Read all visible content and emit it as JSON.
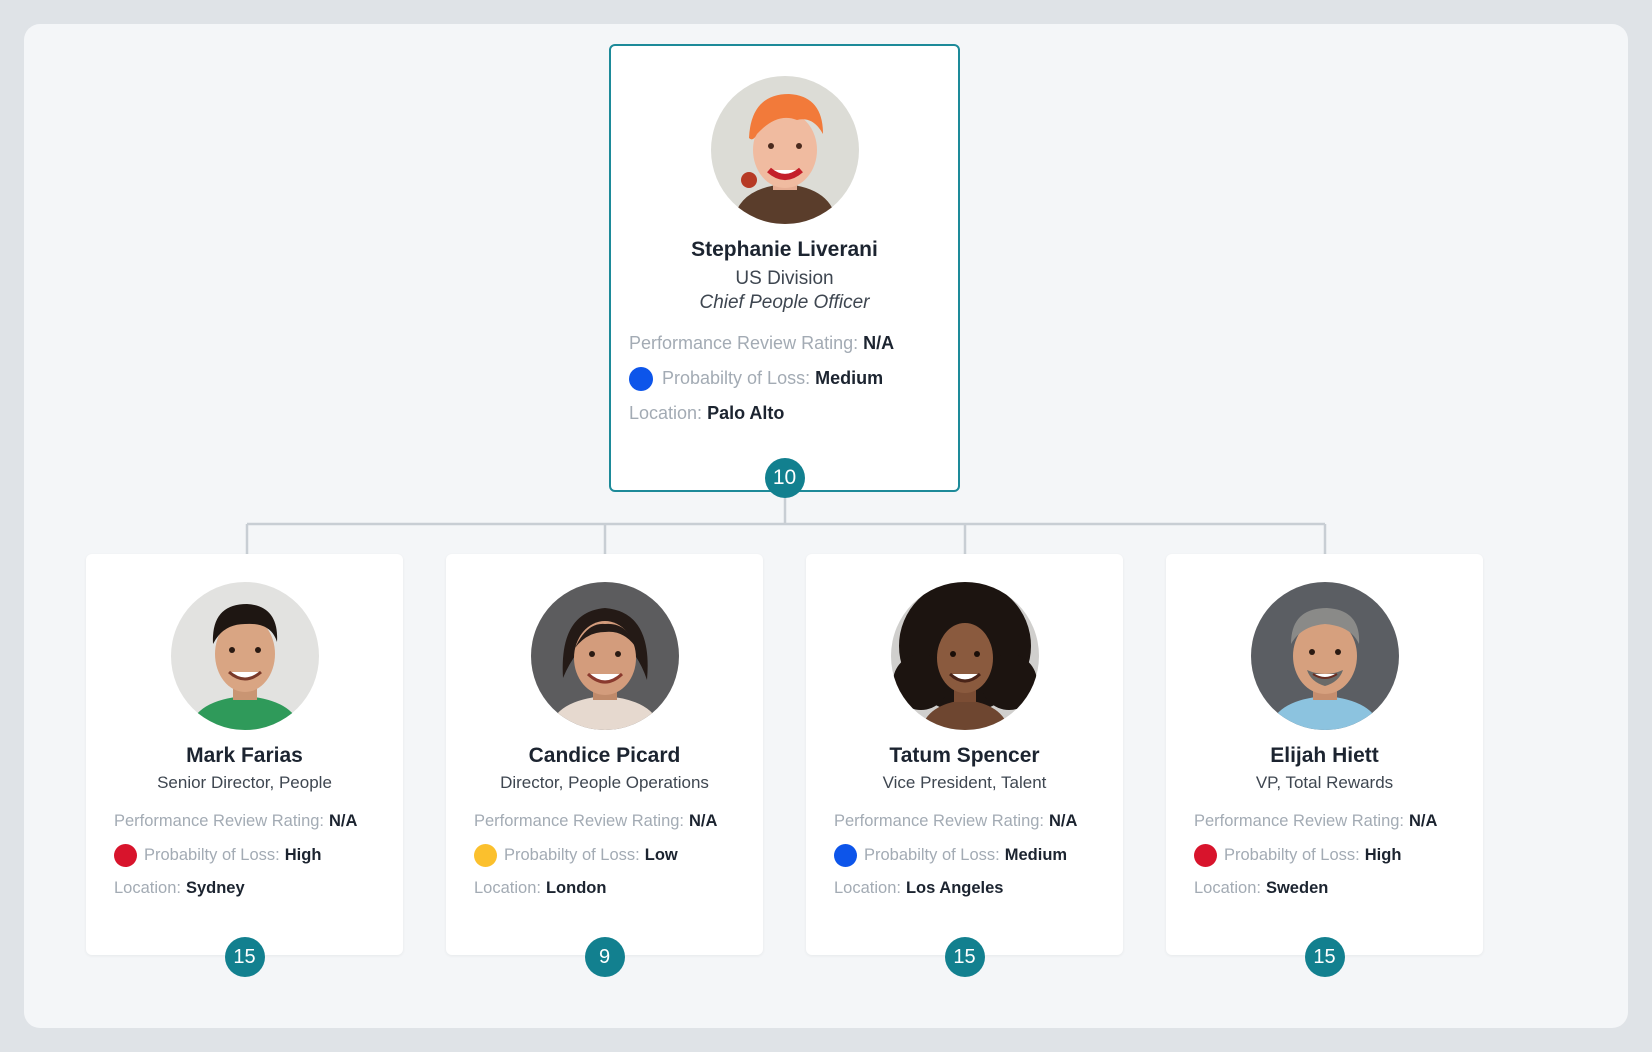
{
  "colors": {
    "accent": "#12808f",
    "root_border": "#1d8a99",
    "connector": "#c8ced4",
    "loss_high": "#d8142c",
    "loss_medium": "#0d55ea",
    "loss_low": "#fbc02d"
  },
  "labels": {
    "rating": "Performance Review Rating:",
    "loss": "Probabilty of Loss:",
    "location": "Location:"
  },
  "root": {
    "name": "Stephanie Liverani",
    "division": "US Division",
    "role": "Chief People Officer",
    "rating": "N/A",
    "loss": "Medium",
    "loss_color": "#0d55ea",
    "location": "Palo Alto",
    "reports": "10",
    "avatar_icon": "person-photo-orange-hair"
  },
  "children": [
    {
      "name": "Mark Farias",
      "title": "Senior Director, People",
      "rating": "N/A",
      "loss": "High",
      "loss_color": "#d8142c",
      "location": "Sydney",
      "reports": "15",
      "avatar_icon": "person-photo-green-shirt"
    },
    {
      "name": "Candice Picard",
      "title": "Director, People Operations",
      "rating": "N/A",
      "loss": "Low",
      "loss_color": "#fbc02d",
      "location": "London",
      "reports": "9",
      "avatar_icon": "person-photo-dark-hair"
    },
    {
      "name": "Tatum Spencer",
      "title": "Vice President, Talent",
      "rating": "N/A",
      "loss": "Medium",
      "loss_color": "#0d55ea",
      "location": "Los Angeles",
      "reports": "15",
      "avatar_icon": "person-photo-curly-hair"
    },
    {
      "name": "Elijah Hiett",
      "title": "VP, Total Rewards",
      "rating": "N/A",
      "loss": "High",
      "loss_color": "#d8142c",
      "location": "Sweden",
      "reports": "15",
      "avatar_icon": "person-photo-gray-hair"
    }
  ]
}
